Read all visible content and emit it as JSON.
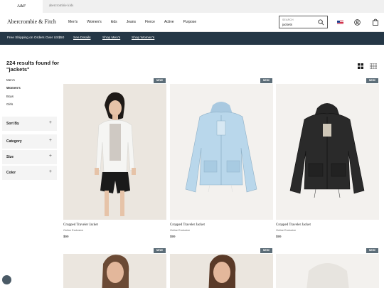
{
  "brands": {
    "active": "A&F",
    "kids": "abercrombie kids"
  },
  "header": {
    "logo": "Abercrombie & Fitch",
    "nav": [
      "Men's",
      "Women's",
      "kids",
      "Jeans",
      "Fierce",
      "Active",
      "Purpose"
    ],
    "search_label": "SEARCH",
    "search_value": "jackets"
  },
  "promo": {
    "text": "Free Shipping on Orders Over US$50",
    "links": [
      "See Details",
      "Shop Men's",
      "Shop Women's"
    ]
  },
  "sidebar": {
    "results": "224 results found for \"jackets\"",
    "genders": [
      "Men's",
      "Women's",
      "Boys",
      "Girls"
    ],
    "facets": [
      "Sort By",
      "Category",
      "Size",
      "Color"
    ],
    "plus": "+"
  },
  "products": [
    {
      "badge": "NEW!",
      "name": "Cropped Traveler Jacket",
      "tag": "Online Exclusive",
      "price": "$99",
      "color": "white"
    },
    {
      "badge": "NEW!",
      "name": "Cropped Traveler Jacket",
      "tag": "Online Exclusive",
      "price": "$99",
      "color": "light-blue"
    },
    {
      "badge": "NEW!",
      "name": "Cropped Traveler Jacket",
      "tag": "Online Exclusive",
      "price": "$99",
      "color": "black"
    },
    {
      "badge": "NEW!"
    },
    {
      "badge": "NEW!"
    },
    {
      "badge": "NEW!"
    }
  ]
}
